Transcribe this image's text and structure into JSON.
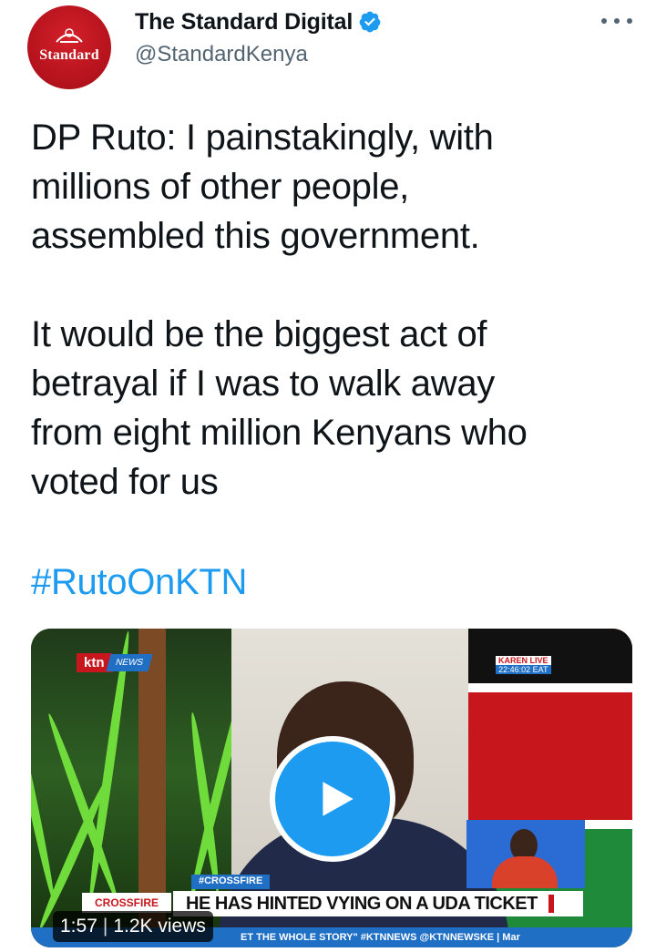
{
  "account": {
    "display_name": "The Standard Digital",
    "handle": "@StandardKenya",
    "avatar_text": "Standard",
    "verified": true
  },
  "tweet": {
    "paragraph_1": "DP Ruto: I painstakingly, with\nmillions of other people,\nassembled this government.",
    "paragraph_2": "It would be the biggest act of\nbetrayal if I was to walk away\nfrom eight million Kenyans who\nvoted for us",
    "hashtag": "#RutoOnKTN"
  },
  "media": {
    "duration": "1:57",
    "separator": "|",
    "views": "1.2K views",
    "broadcast": {
      "channel": "ktn",
      "channel_sub": "NEWS",
      "live_label": "KAREN LIVE",
      "live_time": "22:46:02 EAT",
      "tag": "#CROSSFIRE",
      "show": "CROSSFIRE",
      "headline": "HE HAS HINTED VYING ON A UDA TICKET",
      "ticker": "ET THE WHOLE STORY\" #KTNNEWS @KTNNEWSKE | Mar"
    }
  },
  "colors": {
    "link": "#1d9bf0",
    "text": "#0f1419",
    "secondary": "#536471",
    "verified": "#1d9bf0",
    "avatar_red": "#c8161d"
  },
  "icons": [
    "verified-badge-icon",
    "more-options-icon",
    "play-icon"
  ]
}
